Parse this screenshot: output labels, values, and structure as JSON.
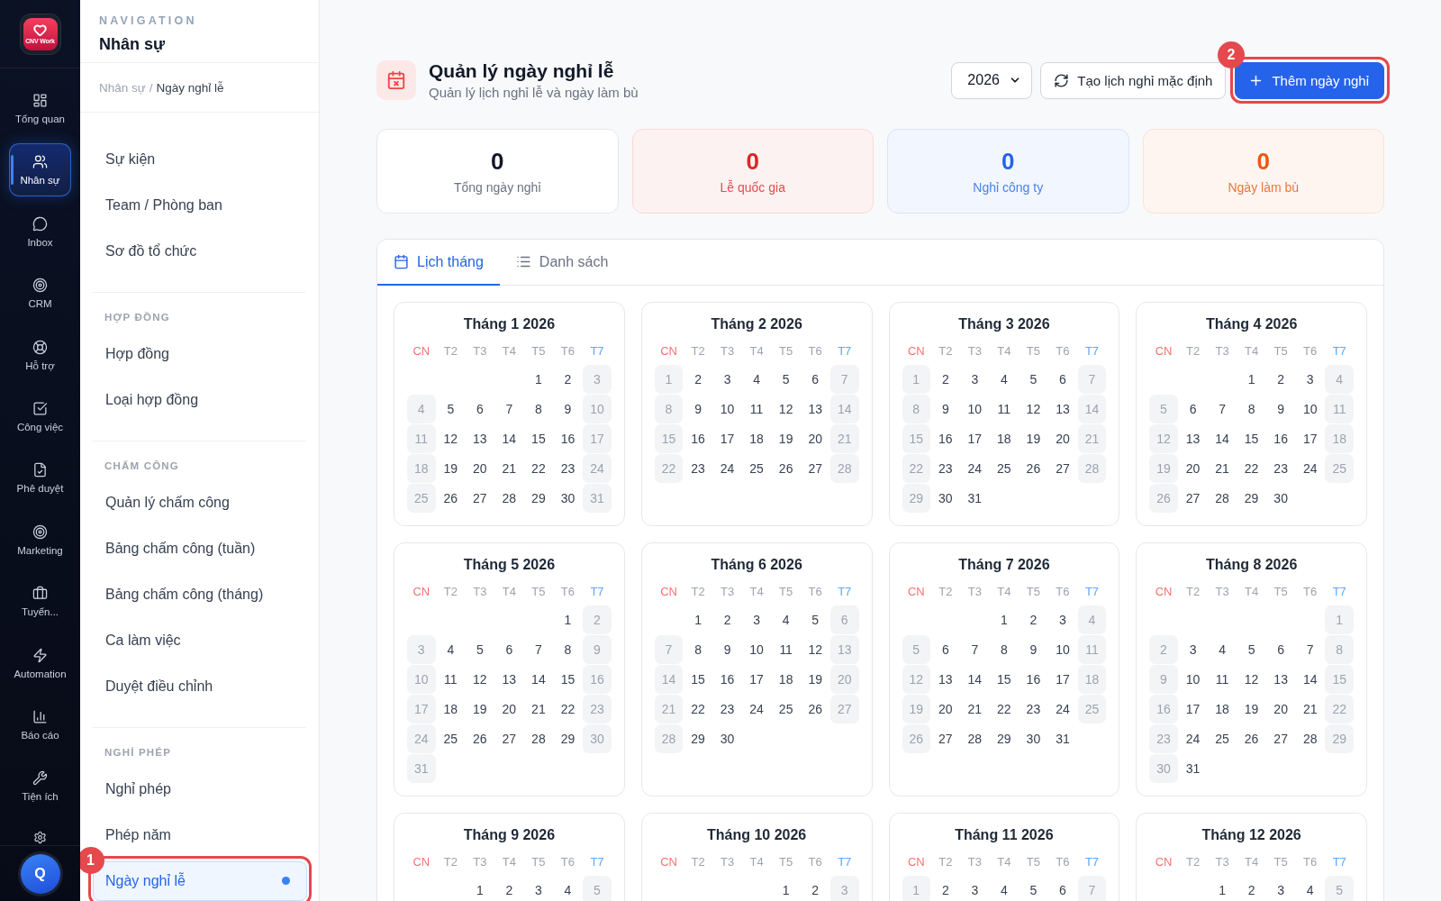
{
  "rail": {
    "logo": {
      "text": "CNV Work"
    },
    "items": [
      {
        "label": "Tổng quan",
        "selected": false
      },
      {
        "label": "Nhân sự",
        "selected": true
      },
      {
        "label": "Inbox",
        "selected": false
      },
      {
        "label": "CRM",
        "selected": false
      },
      {
        "label": "Hỗ trợ",
        "selected": false
      },
      {
        "label": "Công việc",
        "selected": false
      },
      {
        "label": "Phê duyệt",
        "selected": false
      },
      {
        "label": "Marketing",
        "selected": false
      },
      {
        "label": "Tuyển...",
        "selected": false
      },
      {
        "label": "Automation",
        "selected": false
      },
      {
        "label": "Báo cáo",
        "selected": false
      },
      {
        "label": "Tiện ích",
        "selected": false
      },
      {
        "selected": false
      }
    ],
    "user": {
      "initial": "Q"
    }
  },
  "nav": {
    "eyebrow": "NAVIGATION",
    "title": "Nhân sự",
    "breadcrumb": {
      "items": [
        "Nhân sự",
        "Ngày nghỉ lễ"
      ],
      "separator": "/"
    },
    "sections": [
      {
        "items": [
          {
            "label": "Sự kiện",
            "selected": false
          },
          {
            "label": "Team / Phòng ban",
            "selected": false
          },
          {
            "label": "Sơ đồ tổ chức",
            "selected": false
          }
        ]
      },
      {
        "title": "HỢP ĐỒNG",
        "items": [
          {
            "label": "Hợp đồng",
            "selected": false
          },
          {
            "label": "Loại hợp đồng",
            "selected": false
          }
        ]
      },
      {
        "title": "CHẤM CÔNG",
        "items": [
          {
            "label": "Quản lý chấm công",
            "selected": false
          },
          {
            "label": "Bảng chấm công (tuần)",
            "selected": false
          },
          {
            "label": "Bảng chấm công (tháng)",
            "selected": false
          },
          {
            "label": "Ca làm việc",
            "selected": false
          },
          {
            "label": "Duyệt điều chỉnh",
            "selected": false
          }
        ]
      },
      {
        "title": "NGHỈ PHÉP",
        "items": [
          {
            "label": "Nghỉ phép",
            "selected": false
          },
          {
            "label": "Phép năm",
            "selected": false
          },
          {
            "label": "Ngày nghỉ lễ",
            "selected": true,
            "callout": "1"
          }
        ]
      }
    ]
  },
  "header": {
    "title": "Quản lý ngày nghỉ lễ",
    "subtitle": "Quản lý lịch nghỉ lễ và ngày làm bù",
    "year": "2026",
    "actions": [
      {
        "label": "Tạo lịch nghỉ mặc định",
        "kind": "secondary"
      },
      {
        "label": "Thêm ngày nghỉ",
        "kind": "primary",
        "callout": "2"
      }
    ]
  },
  "stats": [
    {
      "value": "0",
      "label": "Tổng ngày nghỉ",
      "kind": "plain",
      "color": "#111827"
    },
    {
      "value": "0",
      "label": "Lễ quốc gia",
      "kind": "tinted",
      "color": "#dc2626"
    },
    {
      "value": "0",
      "label": "Nghỉ công ty",
      "kind": "tinted",
      "color": "#2563eb"
    },
    {
      "value": "0",
      "label": "Ngày làm bù",
      "kind": "tinted",
      "color": "#ea580c"
    }
  ],
  "tabs": [
    {
      "label": "Lịch tháng",
      "selected": true
    },
    {
      "label": "Danh sách",
      "selected": false
    }
  ],
  "months": [
    {
      "title": "Tháng 1 2026",
      "weekdays": [
        {
          "label": "CN",
          "color": "#f87171"
        },
        {
          "label": "T2",
          "color": "#9ca3af"
        },
        {
          "label": "T3",
          "color": "#9ca3af"
        },
        {
          "label": "T4",
          "color": "#9ca3af"
        },
        {
          "label": "T5",
          "color": "#9ca3af"
        },
        {
          "label": "T6",
          "color": "#9ca3af"
        },
        {
          "label": "T7",
          "color": "#60a5fa"
        }
      ],
      "weeks": [
        [
          {
            "day": "1",
            "weekend": false
          },
          {
            "day": "2",
            "weekend": false
          },
          {
            "day": "3",
            "weekend": true
          }
        ],
        [
          {
            "day": "4",
            "weekend": true
          },
          {
            "day": "5",
            "weekend": false
          },
          {
            "day": "6",
            "weekend": false
          },
          {
            "day": "7",
            "weekend": false
          },
          {
            "day": "8",
            "weekend": false
          },
          {
            "day": "9",
            "weekend": false
          },
          {
            "day": "10",
            "weekend": true
          }
        ],
        [
          {
            "day": "11",
            "weekend": true
          },
          {
            "day": "12",
            "weekend": false
          },
          {
            "day": "13",
            "weekend": false
          },
          {
            "day": "14",
            "weekend": false
          },
          {
            "day": "15",
            "weekend": false
          },
          {
            "day": "16",
            "weekend": false
          },
          {
            "day": "17",
            "weekend": true
          }
        ],
        [
          {
            "day": "18",
            "weekend": true
          },
          {
            "day": "19",
            "weekend": false
          },
          {
            "day": "20",
            "weekend": false
          },
          {
            "day": "21",
            "weekend": false
          },
          {
            "day": "22",
            "weekend": false
          },
          {
            "day": "23",
            "weekend": false
          },
          {
            "day": "24",
            "weekend": true
          }
        ],
        [
          {
            "day": "25",
            "weekend": true
          },
          {
            "day": "26",
            "weekend": false
          },
          {
            "day": "27",
            "weekend": false
          },
          {
            "day": "28",
            "weekend": false
          },
          {
            "day": "29",
            "weekend": false
          },
          {
            "day": "30",
            "weekend": false
          },
          {
            "day": "31",
            "weekend": true
          }
        ]
      ]
    },
    {
      "title": "Tháng 2 2026",
      "weekdays": [
        {
          "label": "CN",
          "color": "#f87171"
        },
        {
          "label": "T2",
          "color": "#9ca3af"
        },
        {
          "label": "T3",
          "color": "#9ca3af"
        },
        {
          "label": "T4",
          "color": "#9ca3af"
        },
        {
          "label": "T5",
          "color": "#9ca3af"
        },
        {
          "label": "T6",
          "color": "#9ca3af"
        },
        {
          "label": "T7",
          "color": "#60a5fa"
        }
      ],
      "weeks": [
        [
          {
            "day": "1",
            "weekend": true
          },
          {
            "day": "2",
            "weekend": false
          },
          {
            "day": "3",
            "weekend": false
          },
          {
            "day": "4",
            "weekend": false
          },
          {
            "day": "5",
            "weekend": false
          },
          {
            "day": "6",
            "weekend": false
          },
          {
            "day": "7",
            "weekend": true
          }
        ],
        [
          {
            "day": "8",
            "weekend": true
          },
          {
            "day": "9",
            "weekend": false
          },
          {
            "day": "10",
            "weekend": false
          },
          {
            "day": "11",
            "weekend": false
          },
          {
            "day": "12",
            "weekend": false
          },
          {
            "day": "13",
            "weekend": false
          },
          {
            "day": "14",
            "weekend": true
          }
        ],
        [
          {
            "day": "15",
            "weekend": true
          },
          {
            "day": "16",
            "weekend": false
          },
          {
            "day": "17",
            "weekend": false
          },
          {
            "day": "18",
            "weekend": false
          },
          {
            "day": "19",
            "weekend": false
          },
          {
            "day": "20",
            "weekend": false
          },
          {
            "day": "21",
            "weekend": true
          }
        ],
        [
          {
            "day": "22",
            "weekend": true
          },
          {
            "day": "23",
            "weekend": false
          },
          {
            "day": "24",
            "weekend": false
          },
          {
            "day": "25",
            "weekend": false
          },
          {
            "day": "26",
            "weekend": false
          },
          {
            "day": "27",
            "weekend": false
          },
          {
            "day": "28",
            "weekend": true
          }
        ]
      ]
    },
    {
      "title": "Tháng 3 2026",
      "weekdays": [
        {
          "label": "CN",
          "color": "#f87171"
        },
        {
          "label": "T2",
          "color": "#9ca3af"
        },
        {
          "label": "T3",
          "color": "#9ca3af"
        },
        {
          "label": "T4",
          "color": "#9ca3af"
        },
        {
          "label": "T5",
          "color": "#9ca3af"
        },
        {
          "label": "T6",
          "color": "#9ca3af"
        },
        {
          "label": "T7",
          "color": "#60a5fa"
        }
      ],
      "weeks": [
        [
          {
            "day": "1",
            "weekend": true
          },
          {
            "day": "2",
            "weekend": false
          },
          {
            "day": "3",
            "weekend": false
          },
          {
            "day": "4",
            "weekend": false
          },
          {
            "day": "5",
            "weekend": false
          },
          {
            "day": "6",
            "weekend": false
          },
          {
            "day": "7",
            "weekend": true
          }
        ],
        [
          {
            "day": "8",
            "weekend": true
          },
          {
            "day": "9",
            "weekend": false
          },
          {
            "day": "10",
            "weekend": false
          },
          {
            "day": "11",
            "weekend": false
          },
          {
            "day": "12",
            "weekend": false
          },
          {
            "day": "13",
            "weekend": false
          },
          {
            "day": "14",
            "weekend": true
          }
        ],
        [
          {
            "day": "15",
            "weekend": true
          },
          {
            "day": "16",
            "weekend": false
          },
          {
            "day": "17",
            "weekend": false
          },
          {
            "day": "18",
            "weekend": false
          },
          {
            "day": "19",
            "weekend": false
          },
          {
            "day": "20",
            "weekend": false
          },
          {
            "day": "21",
            "weekend": true
          }
        ],
        [
          {
            "day": "22",
            "weekend": true
          },
          {
            "day": "23",
            "weekend": false
          },
          {
            "day": "24",
            "weekend": false
          },
          {
            "day": "25",
            "weekend": false
          },
          {
            "day": "26",
            "weekend": false
          },
          {
            "day": "27",
            "weekend": false
          },
          {
            "day": "28",
            "weekend": true
          }
        ],
        [
          {
            "day": "29",
            "weekend": true
          },
          {
            "day": "30",
            "weekend": false
          },
          {
            "day": "31",
            "weekend": false
          }
        ]
      ]
    },
    {
      "title": "Tháng 4 2026",
      "weekdays": [
        {
          "label": "CN",
          "color": "#f87171"
        },
        {
          "label": "T2",
          "color": "#9ca3af"
        },
        {
          "label": "T3",
          "color": "#9ca3af"
        },
        {
          "label": "T4",
          "color": "#9ca3af"
        },
        {
          "label": "T5",
          "color": "#9ca3af"
        },
        {
          "label": "T6",
          "color": "#9ca3af"
        },
        {
          "label": "T7",
          "color": "#60a5fa"
        }
      ],
      "weeks": [
        [
          {
            "day": "1",
            "weekend": false
          },
          {
            "day": "2",
            "weekend": false
          },
          {
            "day": "3",
            "weekend": false
          },
          {
            "day": "4",
            "weekend": true
          }
        ],
        [
          {
            "day": "5",
            "weekend": true
          },
          {
            "day": "6",
            "weekend": false
          },
          {
            "day": "7",
            "weekend": false
          },
          {
            "day": "8",
            "weekend": false
          },
          {
            "day": "9",
            "weekend": false
          },
          {
            "day": "10",
            "weekend": false
          },
          {
            "day": "11",
            "weekend": true
          }
        ],
        [
          {
            "day": "12",
            "weekend": true
          },
          {
            "day": "13",
            "weekend": false
          },
          {
            "day": "14",
            "weekend": false
          },
          {
            "day": "15",
            "weekend": false
          },
          {
            "day": "16",
            "weekend": false
          },
          {
            "day": "17",
            "weekend": false
          },
          {
            "day": "18",
            "weekend": true
          }
        ],
        [
          {
            "day": "19",
            "weekend": true
          },
          {
            "day": "20",
            "weekend": false
          },
          {
            "day": "21",
            "weekend": false
          },
          {
            "day": "22",
            "weekend": false
          },
          {
            "day": "23",
            "weekend": false
          },
          {
            "day": "24",
            "weekend": false
          },
          {
            "day": "25",
            "weekend": true
          }
        ],
        [
          {
            "day": "26",
            "weekend": true
          },
          {
            "day": "27",
            "weekend": false
          },
          {
            "day": "28",
            "weekend": false
          },
          {
            "day": "29",
            "weekend": false
          },
          {
            "day": "30",
            "weekend": false
          }
        ]
      ]
    },
    {
      "title": "Tháng 5 2026",
      "weekdays": [
        {
          "label": "CN",
          "color": "#f87171"
        },
        {
          "label": "T2",
          "color": "#9ca3af"
        },
        {
          "label": "T3",
          "color": "#9ca3af"
        },
        {
          "label": "T4",
          "color": "#9ca3af"
        },
        {
          "label": "T5",
          "color": "#9ca3af"
        },
        {
          "label": "T6",
          "color": "#9ca3af"
        },
        {
          "label": "T7",
          "color": "#60a5fa"
        }
      ],
      "weeks": [
        [
          {
            "day": "1",
            "weekend": false
          },
          {
            "day": "2",
            "weekend": true
          }
        ],
        [
          {
            "day": "3",
            "weekend": true
          },
          {
            "day": "4",
            "weekend": false
          },
          {
            "day": "5",
            "weekend": false
          },
          {
            "day": "6",
            "weekend": false
          },
          {
            "day": "7",
            "weekend": false
          },
          {
            "day": "8",
            "weekend": false
          },
          {
            "day": "9",
            "weekend": true
          }
        ],
        [
          {
            "day": "10",
            "weekend": true
          },
          {
            "day": "11",
            "weekend": false
          },
          {
            "day": "12",
            "weekend": false
          },
          {
            "day": "13",
            "weekend": false
          },
          {
            "day": "14",
            "weekend": false
          },
          {
            "day": "15",
            "weekend": false
          },
          {
            "day": "16",
            "weekend": true
          }
        ],
        [
          {
            "day": "17",
            "weekend": true
          },
          {
            "day": "18",
            "weekend": false
          },
          {
            "day": "19",
            "weekend": false
          },
          {
            "day": "20",
            "weekend": false
          },
          {
            "day": "21",
            "weekend": false
          },
          {
            "day": "22",
            "weekend": false
          },
          {
            "day": "23",
            "weekend": true
          }
        ],
        [
          {
            "day": "24",
            "weekend": true
          },
          {
            "day": "25",
            "weekend": false
          },
          {
            "day": "26",
            "weekend": false
          },
          {
            "day": "27",
            "weekend": false
          },
          {
            "day": "28",
            "weekend": false
          },
          {
            "day": "29",
            "weekend": false
          },
          {
            "day": "30",
            "weekend": true
          }
        ],
        [
          {
            "day": "31",
            "weekend": true
          }
        ]
      ]
    },
    {
      "title": "Tháng 6 2026",
      "weekdays": [
        {
          "label": "CN",
          "color": "#f87171"
        },
        {
          "label": "T2",
          "color": "#9ca3af"
        },
        {
          "label": "T3",
          "color": "#9ca3af"
        },
        {
          "label": "T4",
          "color": "#9ca3af"
        },
        {
          "label": "T5",
          "color": "#9ca3af"
        },
        {
          "label": "T6",
          "color": "#9ca3af"
        },
        {
          "label": "T7",
          "color": "#60a5fa"
        }
      ],
      "weeks": [
        [
          {
            "day": "1",
            "weekend": false
          },
          {
            "day": "2",
            "weekend": false
          },
          {
            "day": "3",
            "weekend": false
          },
          {
            "day": "4",
            "weekend": false
          },
          {
            "day": "5",
            "weekend": false
          },
          {
            "day": "6",
            "weekend": true
          }
        ],
        [
          {
            "day": "7",
            "weekend": true
          },
          {
            "day": "8",
            "weekend": false
          },
          {
            "day": "9",
            "weekend": false
          },
          {
            "day": "10",
            "weekend": false
          },
          {
            "day": "11",
            "weekend": false
          },
          {
            "day": "12",
            "weekend": false
          },
          {
            "day": "13",
            "weekend": true
          }
        ],
        [
          {
            "day": "14",
            "weekend": true
          },
          {
            "day": "15",
            "weekend": false
          },
          {
            "day": "16",
            "weekend": false
          },
          {
            "day": "17",
            "weekend": false
          },
          {
            "day": "18",
            "weekend": false
          },
          {
            "day": "19",
            "weekend": false
          },
          {
            "day": "20",
            "weekend": true
          }
        ],
        [
          {
            "day": "21",
            "weekend": true
          },
          {
            "day": "22",
            "weekend": false
          },
          {
            "day": "23",
            "weekend": false
          },
          {
            "day": "24",
            "weekend": false
          },
          {
            "day": "25",
            "weekend": false
          },
          {
            "day": "26",
            "weekend": false
          },
          {
            "day": "27",
            "weekend": true
          }
        ],
        [
          {
            "day": "28",
            "weekend": true
          },
          {
            "day": "29",
            "weekend": false
          },
          {
            "day": "30",
            "weekend": false
          }
        ]
      ]
    },
    {
      "title": "Tháng 7 2026",
      "weekdays": [
        {
          "label": "CN",
          "color": "#f87171"
        },
        {
          "label": "T2",
          "color": "#9ca3af"
        },
        {
          "label": "T3",
          "color": "#9ca3af"
        },
        {
          "label": "T4",
          "color": "#9ca3af"
        },
        {
          "label": "T5",
          "color": "#9ca3af"
        },
        {
          "label": "T6",
          "color": "#9ca3af"
        },
        {
          "label": "T7",
          "color": "#60a5fa"
        }
      ],
      "weeks": [
        [
          {
            "day": "1",
            "weekend": false
          },
          {
            "day": "2",
            "weekend": false
          },
          {
            "day": "3",
            "weekend": false
          },
          {
            "day": "4",
            "weekend": true
          }
        ],
        [
          {
            "day": "5",
            "weekend": true
          },
          {
            "day": "6",
            "weekend": false
          },
          {
            "day": "7",
            "weekend": false
          },
          {
            "day": "8",
            "weekend": false
          },
          {
            "day": "9",
            "weekend": false
          },
          {
            "day": "10",
            "weekend": false
          },
          {
            "day": "11",
            "weekend": true
          }
        ],
        [
          {
            "day": "12",
            "weekend": true
          },
          {
            "day": "13",
            "weekend": false
          },
          {
            "day": "14",
            "weekend": false
          },
          {
            "day": "15",
            "weekend": false
          },
          {
            "day": "16",
            "weekend": false
          },
          {
            "day": "17",
            "weekend": false
          },
          {
            "day": "18",
            "weekend": true
          }
        ],
        [
          {
            "day": "19",
            "weekend": true
          },
          {
            "day": "20",
            "weekend": false
          },
          {
            "day": "21",
            "weekend": false
          },
          {
            "day": "22",
            "weekend": false
          },
          {
            "day": "23",
            "weekend": false
          },
          {
            "day": "24",
            "weekend": false
          },
          {
            "day": "25",
            "weekend": true
          }
        ],
        [
          {
            "day": "26",
            "weekend": true
          },
          {
            "day": "27",
            "weekend": false
          },
          {
            "day": "28",
            "weekend": false
          },
          {
            "day": "29",
            "weekend": false
          },
          {
            "day": "30",
            "weekend": false
          },
          {
            "day": "31",
            "weekend": false
          }
        ]
      ]
    },
    {
      "title": "Tháng 8 2026",
      "weekdays": [
        {
          "label": "CN",
          "color": "#f87171"
        },
        {
          "label": "T2",
          "color": "#9ca3af"
        },
        {
          "label": "T3",
          "color": "#9ca3af"
        },
        {
          "label": "T4",
          "color": "#9ca3af"
        },
        {
          "label": "T5",
          "color": "#9ca3af"
        },
        {
          "label": "T6",
          "color": "#9ca3af"
        },
        {
          "label": "T7",
          "color": "#60a5fa"
        }
      ],
      "weeks": [
        [
          {
            "day": "1",
            "weekend": true
          }
        ],
        [
          {
            "day": "2",
            "weekend": true
          },
          {
            "day": "3",
            "weekend": false
          },
          {
            "day": "4",
            "weekend": false
          },
          {
            "day": "5",
            "weekend": false
          },
          {
            "day": "6",
            "weekend": false
          },
          {
            "day": "7",
            "weekend": false
          },
          {
            "day": "8",
            "weekend": true
          }
        ],
        [
          {
            "day": "9",
            "weekend": true
          },
          {
            "day": "10",
            "weekend": false
          },
          {
            "day": "11",
            "weekend": false
          },
          {
            "day": "12",
            "weekend": false
          },
          {
            "day": "13",
            "weekend": false
          },
          {
            "day": "14",
            "weekend": false
          },
          {
            "day": "15",
            "weekend": true
          }
        ],
        [
          {
            "day": "16",
            "weekend": true
          },
          {
            "day": "17",
            "weekend": false
          },
          {
            "day": "18",
            "weekend": false
          },
          {
            "day": "19",
            "weekend": false
          },
          {
            "day": "20",
            "weekend": false
          },
          {
            "day": "21",
            "weekend": false
          },
          {
            "day": "22",
            "weekend": true
          }
        ],
        [
          {
            "day": "23",
            "weekend": true
          },
          {
            "day": "24",
            "weekend": false
          },
          {
            "day": "25",
            "weekend": false
          },
          {
            "day": "26",
            "weekend": false
          },
          {
            "day": "27",
            "weekend": false
          },
          {
            "day": "28",
            "weekend": false
          },
          {
            "day": "29",
            "weekend": true
          }
        ],
        [
          {
            "day": "30",
            "weekend": true
          },
          {
            "day": "31",
            "weekend": false
          }
        ]
      ]
    },
    {
      "title": "Tháng 9 2026",
      "weekdays": [
        {
          "label": "CN",
          "color": "#f87171"
        },
        {
          "label": "T2",
          "color": "#9ca3af"
        },
        {
          "label": "T3",
          "color": "#9ca3af"
        },
        {
          "label": "T4",
          "color": "#9ca3af"
        },
        {
          "label": "T5",
          "color": "#9ca3af"
        },
        {
          "label": "T6",
          "color": "#9ca3af"
        },
        {
          "label": "T7",
          "color": "#60a5fa"
        }
      ],
      "weeks": [
        [
          {
            "day": "1",
            "weekend": false
          },
          {
            "day": "2",
            "weekend": false
          },
          {
            "day": "3",
            "weekend": false
          },
          {
            "day": "4",
            "weekend": false
          },
          {
            "day": "5",
            "weekend": true
          }
        ]
      ]
    },
    {
      "title": "Tháng 10 2026",
      "weekdays": [
        {
          "label": "CN",
          "color": "#f87171"
        },
        {
          "label": "T2",
          "color": "#9ca3af"
        },
        {
          "label": "T3",
          "color": "#9ca3af"
        },
        {
          "label": "T4",
          "color": "#9ca3af"
        },
        {
          "label": "T5",
          "color": "#9ca3af"
        },
        {
          "label": "T6",
          "color": "#9ca3af"
        },
        {
          "label": "T7",
          "color": "#60a5fa"
        }
      ],
      "weeks": [
        [
          {
            "day": "1",
            "weekend": false
          },
          {
            "day": "2",
            "weekend": false
          },
          {
            "day": "3",
            "weekend": true
          }
        ]
      ]
    },
    {
      "title": "Tháng 11 2026",
      "weekdays": [
        {
          "label": "CN",
          "color": "#f87171"
        },
        {
          "label": "T2",
          "color": "#9ca3af"
        },
        {
          "label": "T3",
          "color": "#9ca3af"
        },
        {
          "label": "T4",
          "color": "#9ca3af"
        },
        {
          "label": "T5",
          "color": "#9ca3af"
        },
        {
          "label": "T6",
          "color": "#9ca3af"
        },
        {
          "label": "T7",
          "color": "#60a5fa"
        }
      ],
      "weeks": [
        [
          {
            "day": "1",
            "weekend": true
          },
          {
            "day": "2",
            "weekend": false
          },
          {
            "day": "3",
            "weekend": false
          },
          {
            "day": "4",
            "weekend": false
          },
          {
            "day": "5",
            "weekend": false
          },
          {
            "day": "6",
            "weekend": false
          },
          {
            "day": "7",
            "weekend": true
          }
        ]
      ]
    },
    {
      "title": "Tháng 12 2026",
      "weekdays": [
        {
          "label": "CN",
          "color": "#f87171"
        },
        {
          "label": "T2",
          "color": "#9ca3af"
        },
        {
          "label": "T3",
          "color": "#9ca3af"
        },
        {
          "label": "T4",
          "color": "#9ca3af"
        },
        {
          "label": "T5",
          "color": "#9ca3af"
        },
        {
          "label": "T6",
          "color": "#9ca3af"
        },
        {
          "label": "T7",
          "color": "#60a5fa"
        }
      ],
      "weeks": [
        [
          {
            "day": "1",
            "weekend": false
          },
          {
            "day": "2",
            "weekend": false
          },
          {
            "day": "3",
            "weekend": false
          },
          {
            "day": "4",
            "weekend": false
          },
          {
            "day": "5",
            "weekend": true
          }
        ]
      ]
    }
  ]
}
